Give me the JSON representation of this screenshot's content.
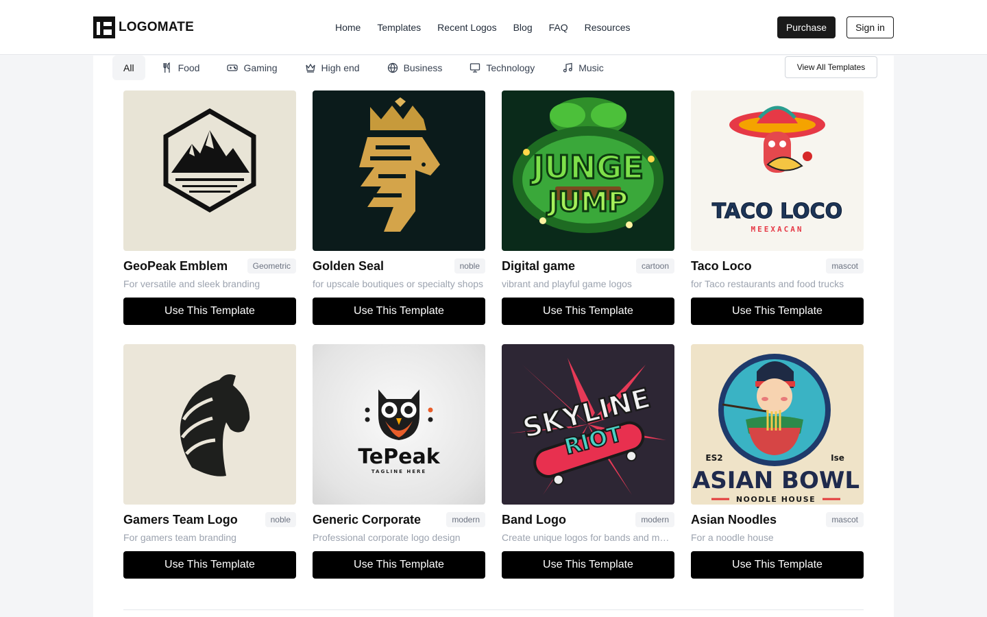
{
  "brand": {
    "name": "LOGOMATE"
  },
  "nav": [
    "Home",
    "Templates",
    "Recent Logos",
    "Blog",
    "FAQ",
    "Resources"
  ],
  "actions": {
    "purchase": "Purchase",
    "sign_in": "Sign in"
  },
  "filters": [
    {
      "label": "All",
      "icon": "",
      "active": true
    },
    {
      "label": "Food",
      "icon": "utensils-icon"
    },
    {
      "label": "Gaming",
      "icon": "gamepad-icon"
    },
    {
      "label": "High end",
      "icon": "crown-icon"
    },
    {
      "label": "Business",
      "icon": "globe-icon"
    },
    {
      "label": "Technology",
      "icon": "monitor-icon"
    },
    {
      "label": "Music",
      "icon": "music-note-icon"
    }
  ],
  "view_all": "View All Templates",
  "cta_label": "Use This Template",
  "cards": [
    {
      "title": "GeoPeak Emblem",
      "tag": "Geometric",
      "desc": "For versatile and sleek branding",
      "art": "mountain-emblem"
    },
    {
      "title": "Golden Seal",
      "tag": "noble",
      "desc": "for upscale boutiques or specialty shops",
      "art": "golden-lion"
    },
    {
      "title": "Digital game",
      "tag": "cartoon",
      "desc": "vibrant and playful game logos",
      "art": "jungle-jump",
      "art_text": [
        "JUNGE",
        "JUMP"
      ]
    },
    {
      "title": "Taco Loco",
      "tag": "mascot",
      "desc": "for Taco restaurants and food trucks",
      "art": "taco-loco",
      "art_text": [
        "TACO LOCO",
        "MEEXACAN"
      ]
    },
    {
      "title": "Gamers Team Logo",
      "tag": "noble",
      "desc": "For gamers team branding",
      "art": "horse-head"
    },
    {
      "title": "Generic Corporate",
      "tag": "modern",
      "desc": "Professional corporate logo design",
      "art": "owl",
      "art_text": [
        "TePeak",
        "TAGLINE HERE"
      ]
    },
    {
      "title": "Band Logo",
      "tag": "modern",
      "desc": "Create unique logos for bands and music groups",
      "art": "skyline-riot",
      "art_text": [
        "SKYLINE",
        "RIOT"
      ]
    },
    {
      "title": "Asian Noodles",
      "tag": "mascot",
      "desc": "For a noodle house",
      "art": "asian-bowl",
      "art_text": [
        "ASIAN BOWL",
        "NOODLE HOUSE",
        "ES2",
        "Ise"
      ]
    }
  ]
}
